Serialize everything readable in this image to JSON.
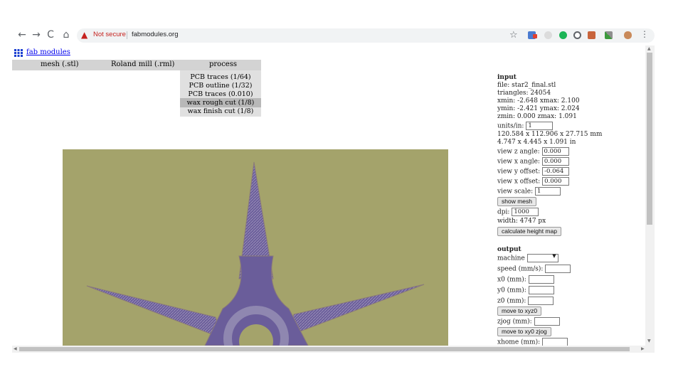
{
  "browser": {
    "back": "←",
    "forward": "→",
    "reload": "C",
    "home": "⌂",
    "warning_icon": "▲",
    "not_secure": "Not secure",
    "url": "fabmodules.org",
    "menu": "⋮"
  },
  "page": {
    "logo_link": "fab modules",
    "menus": [
      "mesh (.stl)",
      "Roland mill (.rml)",
      "process"
    ],
    "process_items": [
      "PCB traces (1/64)",
      "PCB outline (1/32)",
      "PCB traces (0.010)",
      "wax rough cut (1/8)",
      "wax finish cut (1/8)"
    ],
    "selected_process": "wax rough cut (1/8)"
  },
  "input": {
    "heading": "input",
    "file": "file: star2_final.stl",
    "triangles": "triangles: 24054",
    "xrange": "xmin: -2.648 xmax: 2.100",
    "yrange": "ymin: -2.421 ymax: 2.024",
    "zrange": "zmin: 0.000 zmax: 1.091",
    "units_label": "units/in:",
    "units_value": "1",
    "size_mm": "120.584 x 112.906 x 27.715 mm",
    "size_in": "4.747 x 4.445 x 1.091 in",
    "view_z_label": "view z angle:",
    "view_z": "0.000",
    "view_x_label": "view x angle:",
    "view_x": "0.000",
    "view_y_off_label": "view y offset:",
    "view_y_off": "-0.064",
    "view_x_off_label": "view x offset:",
    "view_x_off": "0.000",
    "view_scale_label": "view scale:",
    "view_scale": "1",
    "show_mesh": "show mesh",
    "dpi_label": "dpi:",
    "dpi": "1000",
    "width": "width: 4747 px",
    "calc": "calculate height map"
  },
  "output": {
    "heading": "output",
    "machine_label": "machine",
    "speed_label": "speed (mm/s):",
    "x0_label": "x0 (mm):",
    "y0_label": "y0 (mm):",
    "z0_label": "z0 (mm):",
    "move_xyz0": "move to xyz0",
    "zjog_label": "zjog (mm):",
    "move_xy0_zjog": "move to xy0 zjog",
    "xhome_label": "xhome (mm):"
  },
  "colors": {
    "canvas_bg": "#a4a36b",
    "star_fill": "#6a5d9a",
    "star_edge": "#8a7a7a",
    "link": "#0000ee",
    "warning": "#c5221f"
  }
}
